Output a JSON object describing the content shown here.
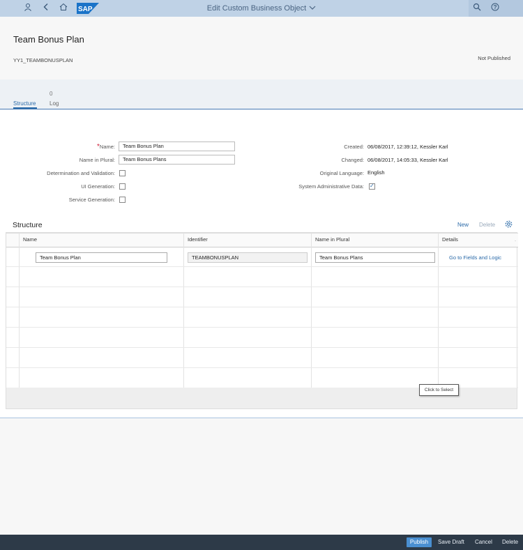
{
  "shell": {
    "title": "Edit Custom Business Object",
    "icons": [
      "user-icon",
      "back-icon",
      "home-icon",
      "sap-logo",
      "search-icon",
      "help-icon"
    ],
    "logo_text": "SAP"
  },
  "header": {
    "title": "Team Bonus Plan",
    "identifier": "YY1_TEAMBONUSPLAN",
    "status": "Not Published"
  },
  "tabs": [
    {
      "label": "Structure",
      "count": ""
    },
    {
      "label": "Log",
      "count": "0"
    }
  ],
  "form": {
    "name_label": "Name:",
    "name_value": "Team Bonus Plan",
    "plural_label": "Name in Plural:",
    "plural_value": "Team Bonus Plans",
    "determination_label": "Determination and Validation:",
    "ui_generation_label": "UI Generation:",
    "service_generation_label": "Service Generation:",
    "created_label": "Created:",
    "created_value": "06/08/2017, 12:39:12, Kessler Karl",
    "changed_label": "Changed:",
    "changed_value": "06/08/2017, 14:05:33, Kessler Karl",
    "language_label": "Original Language:",
    "language_value": "English",
    "system_admin_label": "System Administrative Data:"
  },
  "structure": {
    "title": "Structure",
    "new_label": "New",
    "delete_label": "Delete",
    "columns": [
      "Name",
      "Identifier",
      "Name in Plural",
      "Details"
    ],
    "rows": [
      {
        "name": "Team Bonus Plan",
        "identifier": "TEAMBONUSPLAN",
        "plural": "Team Bonus Plans",
        "details": "Go to Fields and Logic"
      }
    ],
    "tooltip": "Click to Select"
  },
  "footer": {
    "publish": "Publish",
    "save_draft": "Save Draft",
    "cancel": "Cancel",
    "delete": "Delete"
  },
  "colors": {
    "shell": "#bfd2e6",
    "accent": "#2b6aa8",
    "footer": "#2d3a48",
    "required": "#d0203a"
  }
}
